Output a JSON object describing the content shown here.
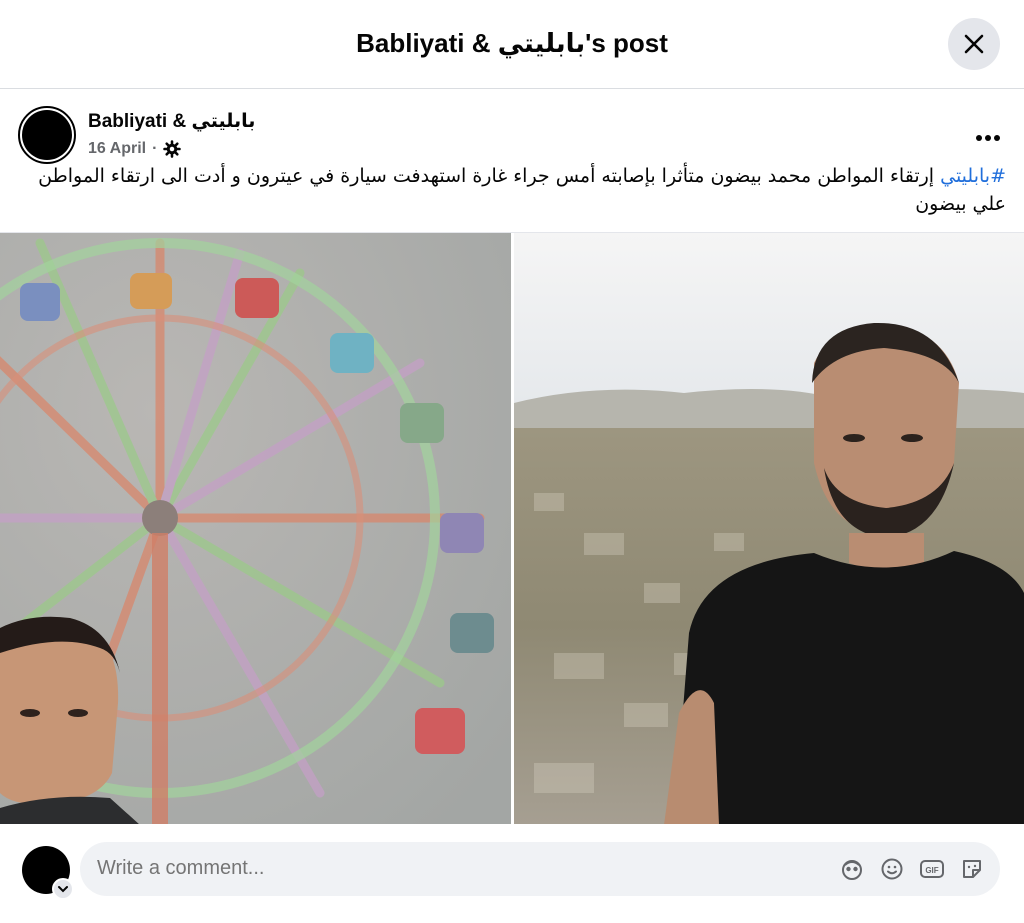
{
  "header": {
    "title": "Babliyati & بابليتي's post"
  },
  "post": {
    "author": "Babliyati & بابليتي",
    "date": "16 April",
    "date_separator": "·",
    "hashtag": "#بابليتي",
    "text": " إرتقاء المواطن محمد بيضون متأثرا بإصابته أمس جراء غارة استهدفت سيارة في عيترون و أدت الى ارتقاء المواطن علي بيضون"
  },
  "comment": {
    "placeholder": "Write a comment..."
  },
  "icons": {
    "close": "close-icon",
    "more": "more-icon",
    "audience": "gear-icon",
    "avatar_badge": "chevron-down-icon",
    "comment_icons": [
      "avatar-sticker-icon",
      "emoji-icon",
      "gif-icon",
      "sticker-icon"
    ]
  },
  "colors": {
    "hashtag": "#216fdb",
    "input_bg": "#f0f2f5",
    "secondary_text": "#65676b"
  }
}
